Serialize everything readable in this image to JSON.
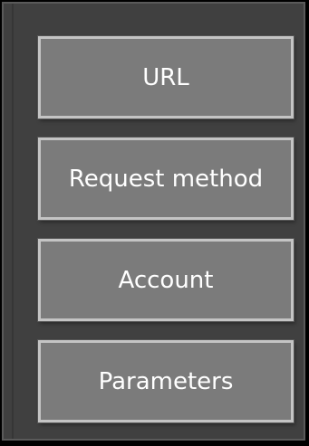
{
  "buttons": {
    "url": "URL",
    "request_method": "Request method",
    "account": "Account",
    "parameters": "Parameters"
  }
}
